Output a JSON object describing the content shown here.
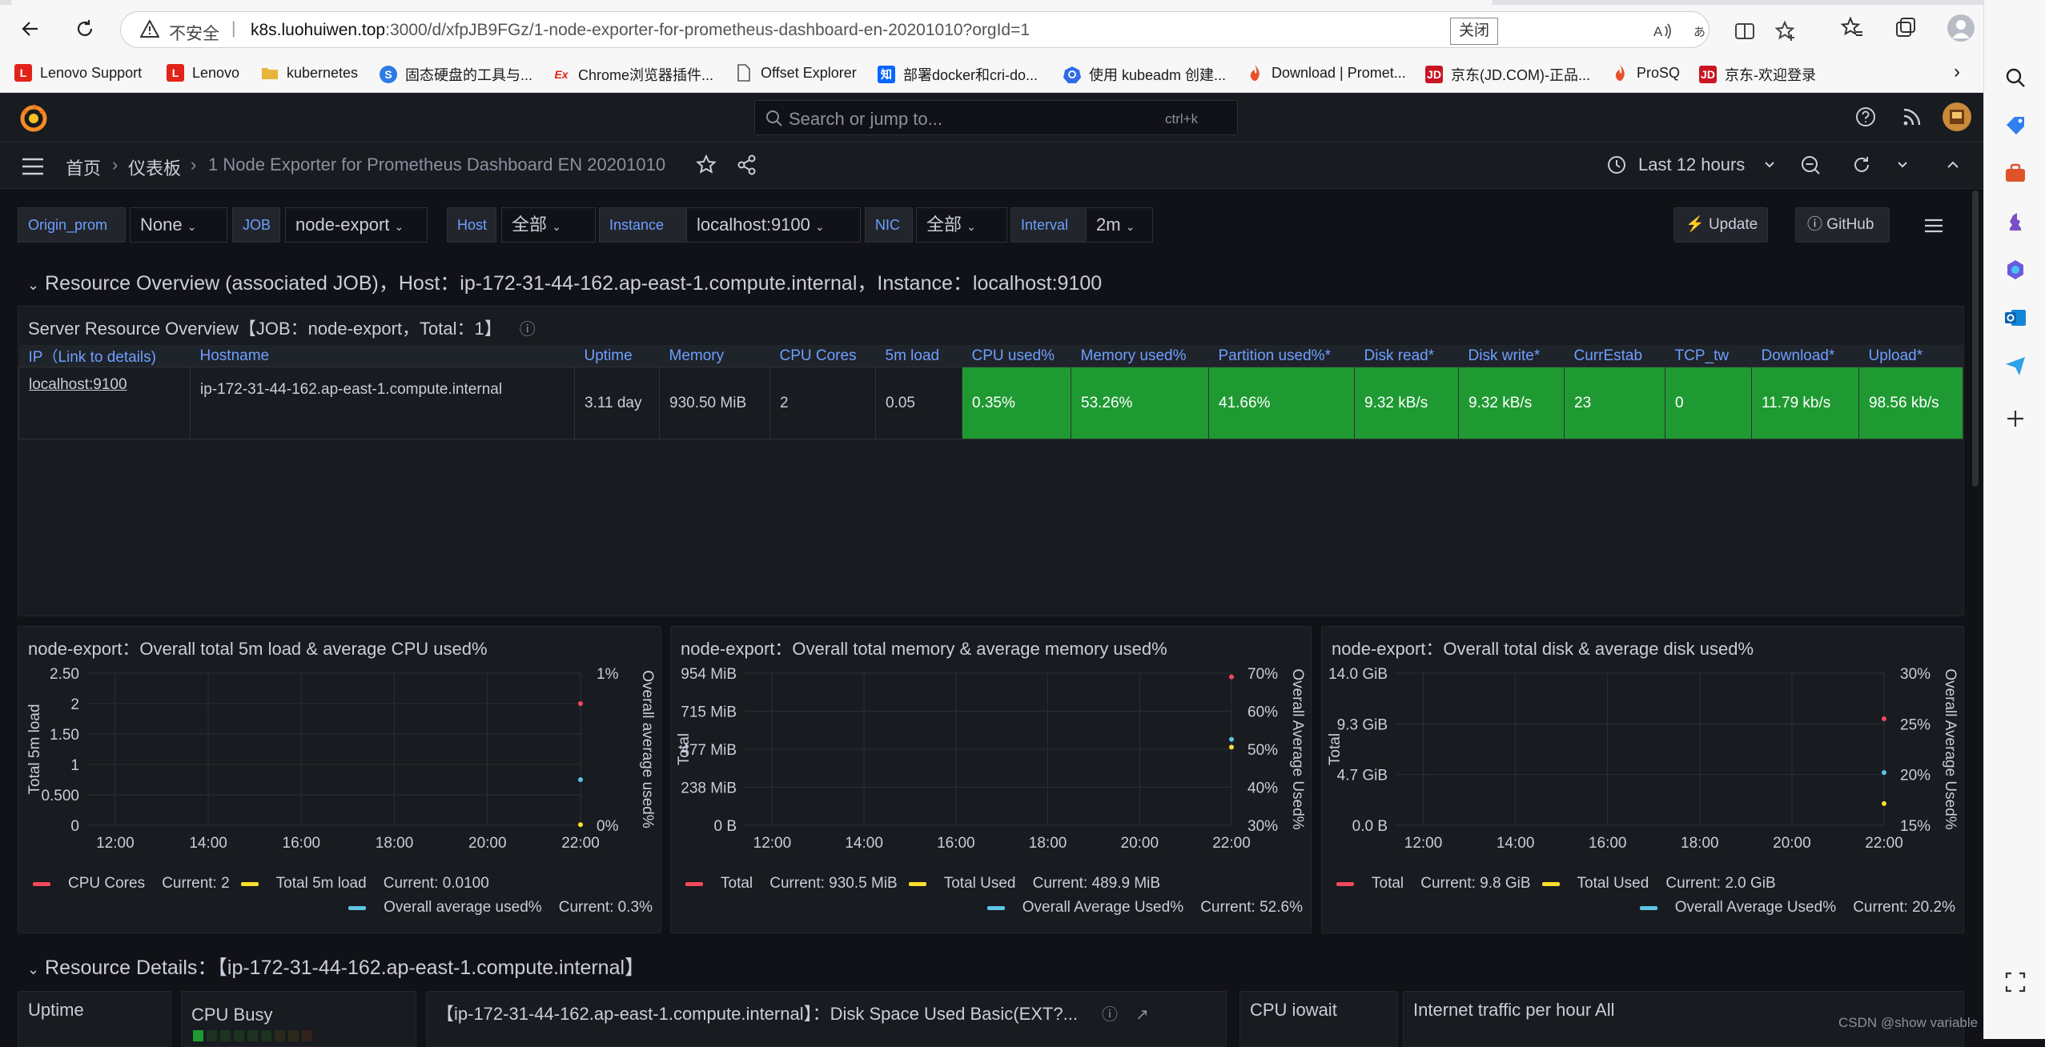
{
  "browser": {
    "insecure_label": "不安全",
    "url_host": "k8s.luohuiwen.top",
    "url_rest": ":3000/d/xfpJB9FGz/1-node-exporter-for-prometheus-dashboard-en-20201010?orgId=1",
    "tooltip": "关闭",
    "bookmarks": [
      {
        "label": "Lenovo Support",
        "icon": "L",
        "color": "#e2231a"
      },
      {
        "label": "Lenovo",
        "icon": "L",
        "color": "#e2231a"
      },
      {
        "label": "kubernetes",
        "icon": "folder",
        "color": "#e8b53a"
      },
      {
        "label": "固态硬盘的工具与...",
        "icon": "S",
        "color": "#2d7be5"
      },
      {
        "label": "Chrome浏览器插件...",
        "icon": "Ex",
        "color": "#e2231a"
      },
      {
        "label": "Offset Explorer",
        "icon": "page",
        "color": "#777777"
      },
      {
        "label": "部署docker和cri-do...",
        "icon": "知",
        "color": "#0a66ff"
      },
      {
        "label": "使用 kubeadm 创建...",
        "icon": "k8s",
        "color": "#326ce5"
      },
      {
        "label": "Download | Promet...",
        "icon": "fire",
        "color": "#e6522c"
      },
      {
        "label": "京东(JD.COM)-正品...",
        "icon": "JD",
        "color": "#c91623"
      },
      {
        "label": "ProSQ",
        "icon": "fire",
        "color": "#e6522c"
      },
      {
        "label": "京东-欢迎登录",
        "icon": "JD",
        "color": "#c91623"
      }
    ]
  },
  "grafana": {
    "search_placeholder": "Search or jump to...",
    "search_shortcut": "ctrl+k",
    "breadcrumb": [
      "首页",
      "仪表板",
      "1 Node Exporter for Prometheus Dashboard EN 20201010"
    ],
    "time_range": "Last 12 hours",
    "variables": [
      {
        "label": "Origin_prom",
        "value": "None"
      },
      {
        "label": "JOB",
        "value": "node-export"
      },
      {
        "label": "Host",
        "value": "全部"
      },
      {
        "label": "Instance",
        "value": "localhost:9100"
      },
      {
        "label": "NIC",
        "value": "全部"
      },
      {
        "label": "Interval",
        "value": "2m"
      }
    ],
    "update_label": "Update",
    "github_label": "GitHub",
    "row1_title": "Resource Overview (associated JOB)，Host：ip-172-31-44-162.ap-east-1.compute.internal，Instance：localhost:9100",
    "overview_title": "Server Resource Overview【JOB：node-export，Total：1】",
    "table": {
      "headers": [
        "IP（Link to details)",
        "Hostname",
        "Uptime",
        "Memory",
        "CPU Cores",
        "5m load",
        "CPU used%",
        "Memory used%",
        "Partition used%*",
        "Disk read*",
        "Disk write*",
        "CurrEstab",
        "TCP_tw",
        "Download*",
        "Upload*"
      ],
      "row": [
        "localhost:9100",
        "ip-172-31-44-162.ap-east-1.compute.internal",
        "3.11 day",
        "930.50 MiB",
        "2",
        "0.05",
        "0.35%",
        "53.26%",
        "41.66%",
        "9.32 kB/s",
        "9.32 kB/s",
        "23",
        "0",
        "11.79 kb/s",
        "98.56 kb/s"
      ]
    },
    "row2_title": "Resource Details：【ip-172-31-44-162.ap-east-1.compute.internal】",
    "bottom_panels": [
      "Uptime",
      "CPU Busy",
      "【ip-172-31-44-162.ap-east-1.compute.internal】：Disk Space Used Basic(EXT?...",
      "CPU iowait",
      "Internet traffic per hour All"
    ],
    "watermark": "CSDN @show variable",
    "colors": {
      "accent": "#6e9fff",
      "green_cell": "#1f9a32",
      "bg": "#111217",
      "panel": "#181b1f",
      "red": "#f2495c",
      "yellow": "#fade2a",
      "blue": "#5dc4e8"
    }
  },
  "chart_data": [
    {
      "type": "line",
      "title": "node-export：Overall total 5m load & average CPU used%",
      "x": [
        "12:00",
        "14:00",
        "16:00",
        "18:00",
        "20:00",
        "22:00"
      ],
      "ylabel": "Total 5m load",
      "y_ticks": [
        "2.50",
        "2",
        "1.50",
        "1",
        "0.500",
        "0"
      ],
      "ylim": [
        0,
        2.5
      ],
      "y2label": "Overall average used%",
      "y2_ticks": [
        "1%",
        "0%"
      ],
      "y2lim": [
        0,
        1
      ],
      "series": [
        {
          "name": "CPU Cores",
          "legend": "CPU Cores    Current: 2",
          "color": "#f2495c",
          "axis": "left",
          "x": "22:00",
          "value": 2
        },
        {
          "name": "Total 5m load",
          "legend": "Total 5m load    Current: 0.0100",
          "color": "#fade2a",
          "axis": "left",
          "x": "22:00",
          "value": 0.01
        },
        {
          "name": "Overall average used%",
          "legend": "Overall average used%    Current: 0.3%",
          "color": "#5dc4e8",
          "axis": "right",
          "x": "22:00",
          "value": 0.3
        }
      ]
    },
    {
      "type": "line",
      "title": "node-export：Overall total memory & average memory used%",
      "x": [
        "12:00",
        "14:00",
        "16:00",
        "18:00",
        "20:00",
        "22:00"
      ],
      "ylabel": "Total",
      "y_ticks": [
        "954 MiB",
        "715 MiB",
        "477 MiB",
        "238 MiB",
        "0 B"
      ],
      "ylim": [
        0,
        954
      ],
      "y2label": "Overall Average Used%",
      "y2_ticks": [
        "70%",
        "60%",
        "50%",
        "40%",
        "30%"
      ],
      "y2lim": [
        30,
        70
      ],
      "series": [
        {
          "name": "Total",
          "legend": "Total    Current: 930.5 MiB",
          "color": "#f2495c",
          "axis": "left",
          "x": "22:00",
          "value": 930.5
        },
        {
          "name": "Total Used",
          "legend": "Total Used    Current: 489.9 MiB",
          "color": "#fade2a",
          "axis": "left",
          "x": "22:00",
          "value": 489.9
        },
        {
          "name": "Overall Average Used%",
          "legend": "Overall Average Used%    Current: 52.6%",
          "color": "#5dc4e8",
          "axis": "right",
          "x": "22:00",
          "value": 52.6
        }
      ]
    },
    {
      "type": "line",
      "title": "node-export：Overall total disk & average disk used%",
      "x": [
        "12:00",
        "14:00",
        "16:00",
        "18:00",
        "20:00",
        "22:00"
      ],
      "ylabel": "Total",
      "y_ticks": [
        "14.0 GiB",
        "9.3 GiB",
        "4.7 GiB",
        "0.0 B"
      ],
      "ylim": [
        0,
        14
      ],
      "y2label": "Overall Average Used%",
      "y2_ticks": [
        "30%",
        "25%",
        "20%",
        "15%"
      ],
      "y2lim": [
        15,
        30
      ],
      "series": [
        {
          "name": "Total",
          "legend": "Total    Current: 9.8 GiB",
          "color": "#f2495c",
          "axis": "left",
          "x": "22:00",
          "value": 9.8
        },
        {
          "name": "Total Used",
          "legend": "Total Used    Current: 2.0 GiB",
          "color": "#fade2a",
          "axis": "left",
          "x": "22:00",
          "value": 2.0
        },
        {
          "name": "Overall Average Used%",
          "legend": "Overall Average Used%    Current: 20.2%",
          "color": "#5dc4e8",
          "axis": "right",
          "x": "22:00",
          "value": 20.2
        }
      ]
    }
  ]
}
